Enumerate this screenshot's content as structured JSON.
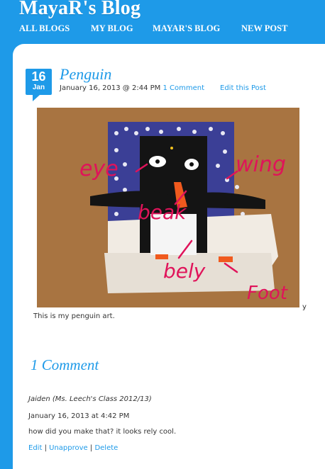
{
  "site": {
    "title": "MayaR's Blog"
  },
  "nav": [
    {
      "label": "ALL BLOGS"
    },
    {
      "label": "MY BLOG"
    },
    {
      "label": "MAYAR'S BLOG"
    },
    {
      "label": "NEW POST"
    }
  ],
  "post": {
    "day": "16",
    "month": "Jan",
    "title": "Penguin",
    "date_text": "January 16, 2013 @ 2:44 PM",
    "comment_link": "1 Comment",
    "edit_link": "Edit this Post",
    "photo_labels": {
      "eye": "eye",
      "wing": "wing",
      "beak": "beak",
      "belly": "bely",
      "foot": "Foot"
    },
    "caption": "This is my penguin art.",
    "stray_char": "y"
  },
  "comments": {
    "heading": "1 Comment",
    "items": [
      {
        "author": "Jaiden (Ms. Leech's Class 2012/13)",
        "date": "January 16, 2013 at 4:42 PM",
        "text": "how did you make that? it looks rely cool.",
        "actions": {
          "edit": "Edit",
          "unapprove": "Unapprove",
          "delete": "Delete",
          "sep": "|"
        }
      }
    ]
  },
  "colors": {
    "accent": "#1e9ae8",
    "panel": "#ffffff",
    "text": "#333333",
    "ink": "#e0135a"
  }
}
